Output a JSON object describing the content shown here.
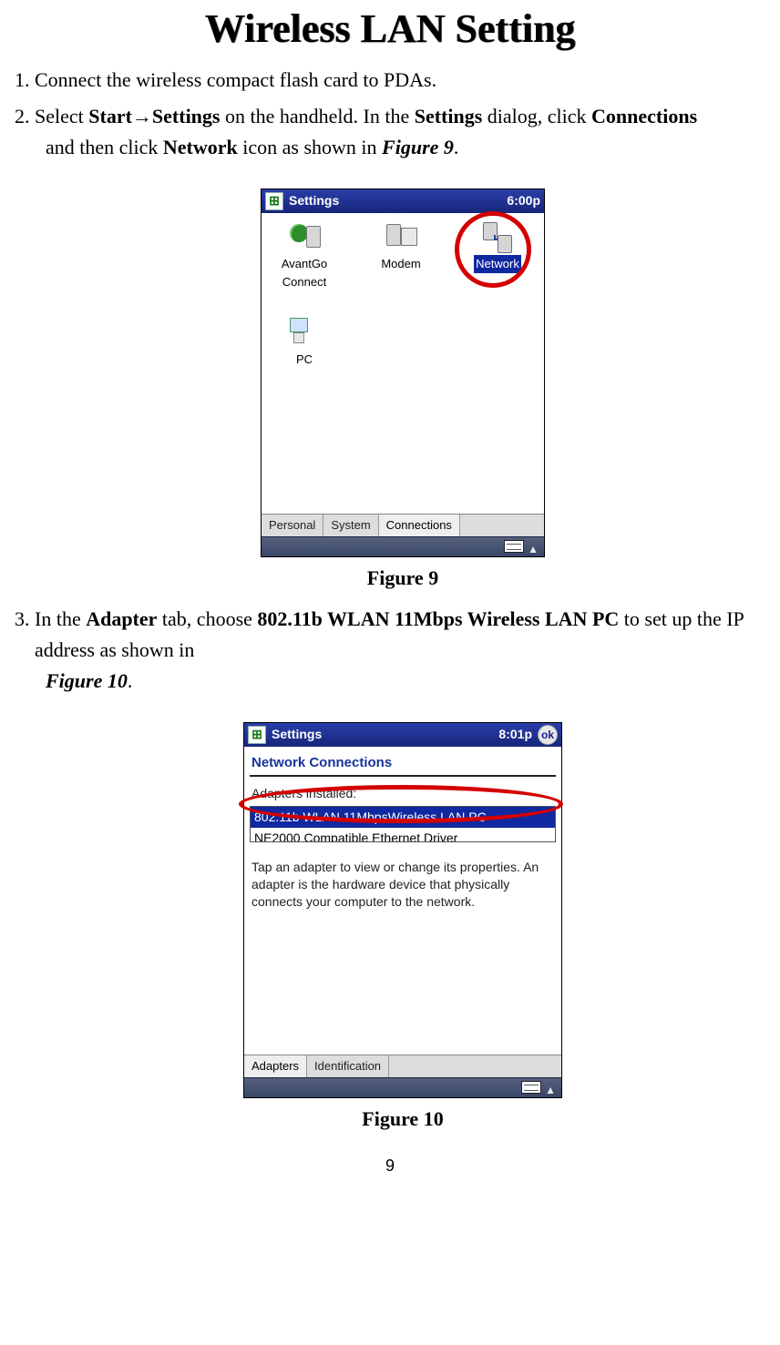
{
  "title": "Wireless LAN Setting",
  "steps": {
    "s1": "Connect the wireless compact flash card to PDAs.",
    "s2_a": "Select ",
    "s2_b_start": "Start",
    "s2_arrow": "→",
    "s2_b_settings": "Settings",
    "s2_c": " on the handheld. In the ",
    "s2_d_settings": "Settings",
    "s2_e": " dialog, click ",
    "s2_f_connections": "Connections",
    "s2_g": " and then click ",
    "s2_h_network": "Network",
    "s2_i": " icon as shown in ",
    "s2_figref": "Figure 9",
    "s2_j": ".",
    "s3_a": "In the ",
    "s3_b_adapter": "Adapter",
    "s3_c": " tab, choose ",
    "s3_d_wlan": "802.11b WLAN 11Mbps Wireless LAN PC",
    "s3_e": " to set up the IP address as shown in ",
    "s3_figref": "Figure 10",
    "s3_f": "."
  },
  "captions": {
    "fig9": "Figure 9",
    "fig10": "Figure 10"
  },
  "screenshot1": {
    "title": "Settings",
    "time": "6:00p",
    "icons": {
      "avantgo": "AvantGo Connect",
      "modem": "Modem",
      "network": "Network",
      "pc": "PC"
    },
    "tabs": {
      "personal": "Personal",
      "system": "System",
      "connections": "Connections"
    }
  },
  "screenshot2": {
    "title": "Settings",
    "time": "8:01p",
    "ok": "ok",
    "section": "Network Connections",
    "label": "Adapters installed:",
    "rows": {
      "r1": "802.11b WLAN 11MbpsWireless LAN PC",
      "r2": "NE2000 Compatible Ethernet Driver"
    },
    "help": "Tap an adapter to view or change its properties. An adapter is the hardware device that physically connects your computer to the network.",
    "tabs": {
      "adapters": "Adapters",
      "identification": "Identification"
    }
  },
  "page_number": "9"
}
